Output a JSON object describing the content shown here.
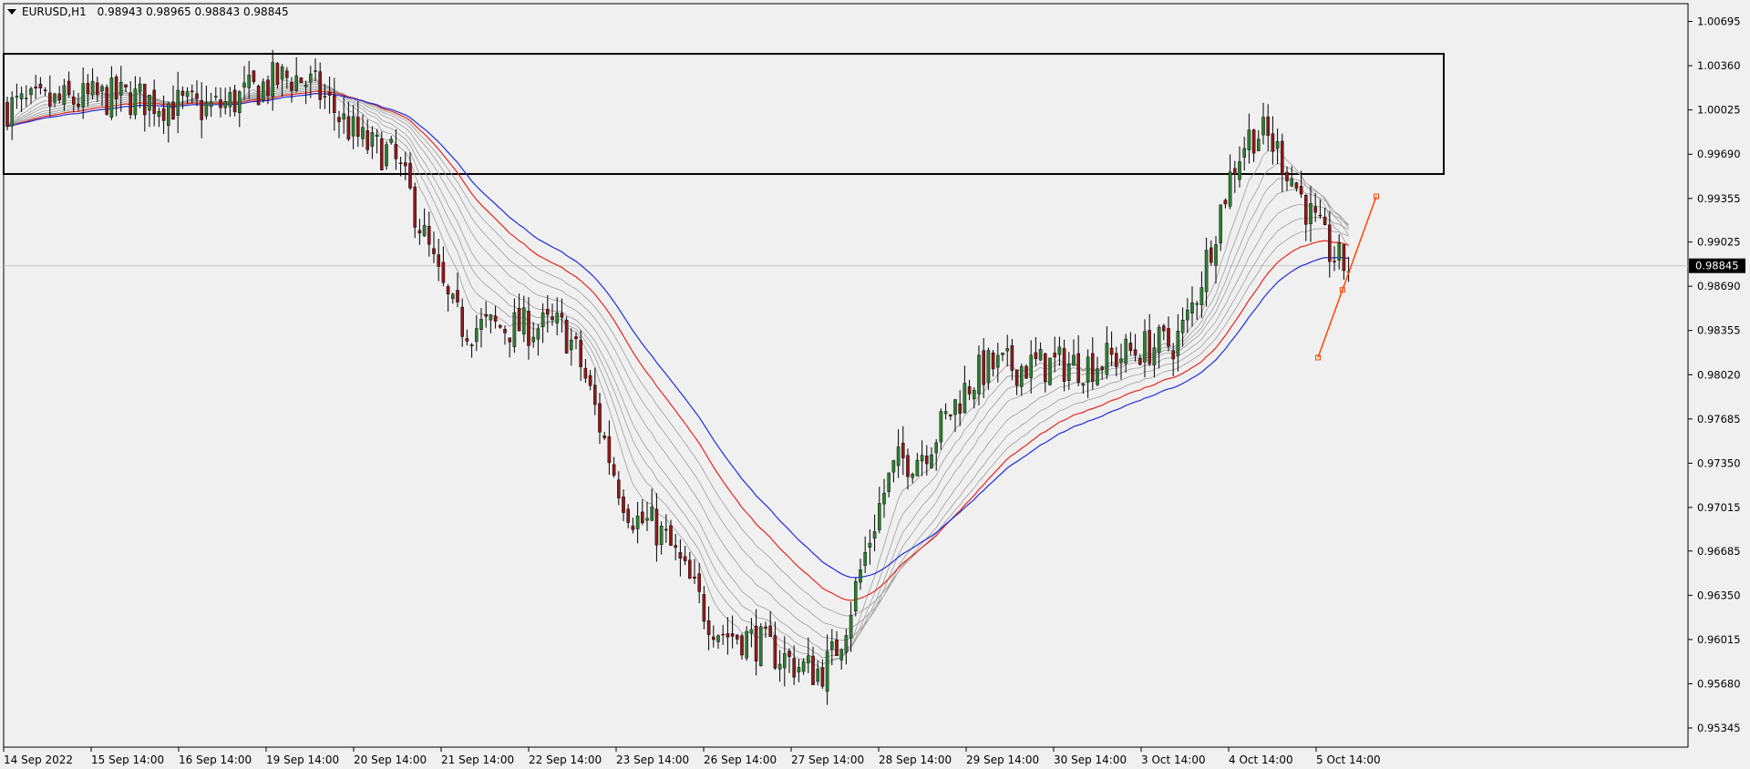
{
  "header": {
    "symbol_timeframe": "EURUSD,H1",
    "ohlc": "0.98943 0.98965 0.98843 0.98845"
  },
  "colors": {
    "background": "#f0f0f0",
    "bull_candle": "#2e7d32",
    "bear_candle": "#8b1a1a",
    "wick": "#000000",
    "ema_fast": "#e8261a",
    "ema_slow": "#1c2de0",
    "ribbon": "#9e9e9e",
    "trendline": "#ff4500",
    "price_tag_bg": "#000000",
    "price_tag_text": "#ffffff",
    "zone_border": "#000000"
  },
  "price_axis": {
    "tick_labels": [
      "1.00695",
      "1.00360",
      "1.00025",
      "0.99690",
      "0.99355",
      "0.99025",
      "0.98690",
      "0.98355",
      "0.98020",
      "0.97685",
      "0.97350",
      "0.97015",
      "0.96685",
      "0.96350",
      "0.96015",
      "0.95680",
      "0.95345"
    ],
    "current_price_label": "0.98845"
  },
  "time_axis": {
    "tick_labels": [
      "14 Sep 2022",
      "15 Sep 14:00",
      "16 Sep 14:00",
      "19 Sep 14:00",
      "20 Sep 14:00",
      "21 Sep 14:00",
      "22 Sep 14:00",
      "23 Sep 14:00",
      "26 Sep 14:00",
      "27 Sep 14:00",
      "28 Sep 14:00",
      "29 Sep 14:00",
      "30 Sep 14:00",
      "3 Oct 14:00",
      "4 Oct 14:00",
      "5 Oct 14:00"
    ]
  },
  "chart_data": {
    "type": "candlestick",
    "symbol": "EURUSD",
    "timeframe": "H1",
    "ylim": [
      0.952,
      1.0083
    ],
    "current_price": 0.98845,
    "resistance_zone": {
      "upper": 1.0045,
      "lower": 0.9954,
      "start_label": "14 Sep 2022",
      "end_label": "5 Oct 14:00"
    },
    "trendline": {
      "from_price": 0.9815,
      "to_price": 0.9937
    },
    "price_path": [
      {
        "label": "14 Sep 2022",
        "price": 1.0005
      },
      {
        "label": "15 Sep 14:00",
        "price": 1.0012
      },
      {
        "label": "16 Sep 14:00",
        "price": 1.0004
      },
      {
        "label": "19 Sep 14:00",
        "price": 1.0027
      },
      {
        "label": "20 Sep 14:00",
        "price": 0.9972
      },
      {
        "label": "21 Sep 14:00",
        "price": 0.9838
      },
      {
        "label": "22 Sep 14:00",
        "price": 0.9838
      },
      {
        "label": "23 Sep 14:00",
        "price": 0.969
      },
      {
        "label": "26 Sep 14:00",
        "price": 0.9605
      },
      {
        "label": "27 Sep 14:00",
        "price": 0.9578
      },
      {
        "label": "28 Sep 14:00",
        "price": 0.9738
      },
      {
        "label": "29 Sep 14:00",
        "price": 0.9808
      },
      {
        "label": "30 Sep 14:00",
        "price": 0.981
      },
      {
        "label": "3 Oct 14:00",
        "price": 0.9825
      },
      {
        "label": "4 Oct 14:00",
        "price": 0.9985
      },
      {
        "label": "5 Oct 14:00",
        "price": 0.98845
      }
    ],
    "series": [
      {
        "name": "",
        "values_approx": [
          1.0012,
          1.001,
          1.001,
          1.0014,
          1.0002,
          0.996,
          0.992,
          0.986,
          0.977,
          0.97,
          0.965,
          0.97,
          0.975,
          0.978,
          0.983,
          0.9868
        ]
      },
      {
        "name": "",
        "values_approx": [
          1.0015,
          1.0012,
          1.0011,
          1.0013,
          1.0006,
          0.9972,
          0.9935,
          0.988,
          0.9795,
          0.972,
          0.965,
          0.9688,
          0.9738,
          0.977,
          0.9812,
          0.9872
        ]
      }
    ]
  }
}
